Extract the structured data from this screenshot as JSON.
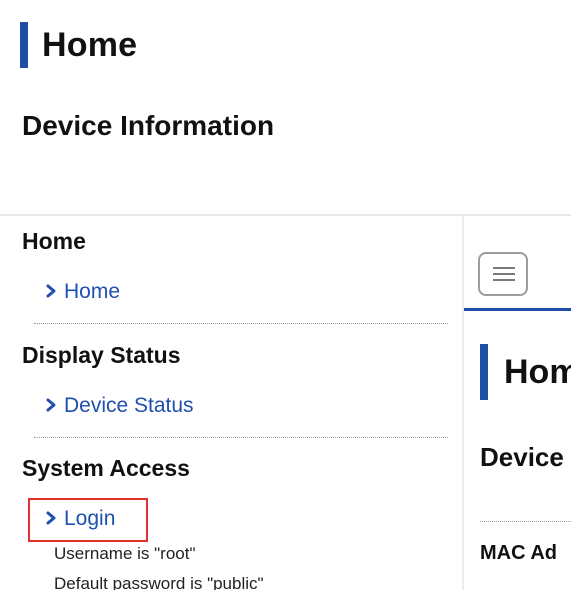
{
  "header": {
    "title": "Home",
    "subtitle": "Device Information"
  },
  "sidebar": {
    "sections": [
      {
        "title": "Home",
        "link": "Home"
      },
      {
        "title": "Display Status",
        "link": "Device Status"
      },
      {
        "title": "System Access",
        "link": "Login"
      }
    ],
    "notes": [
      "Username is \"root\"",
      "Default password is \"public\""
    ]
  },
  "right_pane": {
    "title": "Hom",
    "subtitle": "Device",
    "mac_label": "MAC Ad"
  },
  "colors": {
    "accent_blue": "#1e4ea6",
    "link_blue": "#1f4fb0",
    "highlight_red": "#e2322a"
  },
  "icons": {
    "chevron": "chevron-right-icon",
    "menu": "hamburger-menu-icon"
  }
}
